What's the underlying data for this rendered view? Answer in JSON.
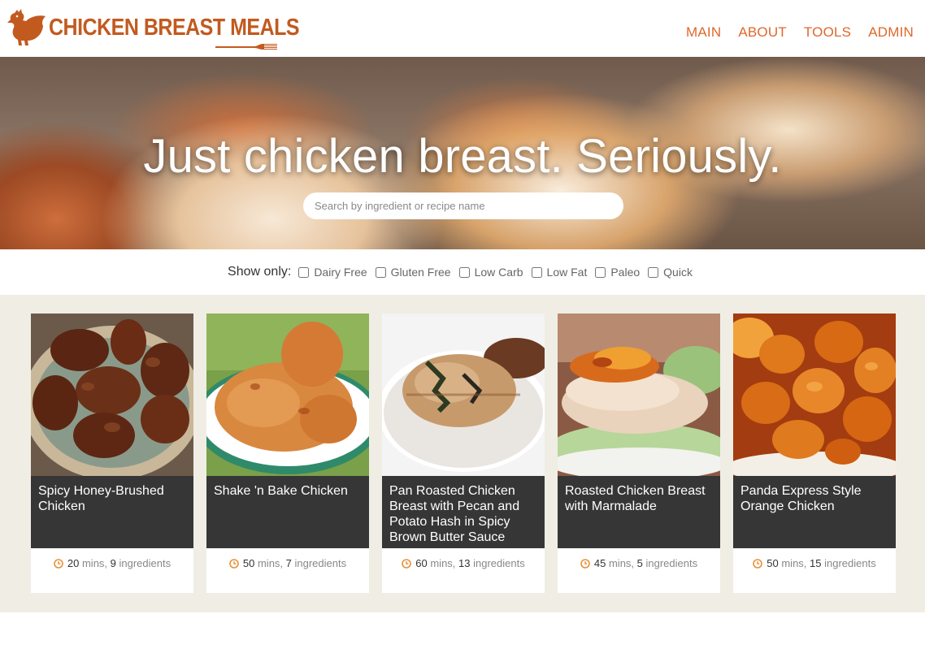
{
  "header": {
    "logo_text": "CHICKEN BREAST MEALS",
    "nav": [
      {
        "label": "MAIN"
      },
      {
        "label": "ABOUT"
      },
      {
        "label": "TOOLS"
      },
      {
        "label": "ADMIN"
      }
    ]
  },
  "hero": {
    "title": "Just chicken breast. Seriously.",
    "search_placeholder": "Search by ingredient or recipe name"
  },
  "filters": {
    "label": "Show only:",
    "options": [
      {
        "label": "Dairy Free",
        "checked": false
      },
      {
        "label": "Gluten Free",
        "checked": false
      },
      {
        "label": "Low Carb",
        "checked": false
      },
      {
        "label": "Low Fat",
        "checked": false
      },
      {
        "label": "Paleo",
        "checked": false
      },
      {
        "label": "Quick",
        "checked": false
      }
    ]
  },
  "recipes": [
    {
      "title": "Spicy Honey-Brushed Chicken",
      "mins": "20",
      "mins_label": " mins, ",
      "ingredients": "9",
      "ingredients_label": " ingredients"
    },
    {
      "title": "Shake 'n Bake Chicken",
      "mins": "50",
      "mins_label": " mins, ",
      "ingredients": "7",
      "ingredients_label": " ingredients"
    },
    {
      "title": "Pan Roasted Chicken Breast with Pecan and Potato Hash in Spicy Brown Butter Sauce",
      "mins": "60",
      "mins_label": " mins, ",
      "ingredients": "13",
      "ingredients_label": " ingredients"
    },
    {
      "title": "Roasted Chicken Breast with Marmalade",
      "mins": "45",
      "mins_label": " mins, ",
      "ingredients": "5",
      "ingredients_label": " ingredients"
    },
    {
      "title": "Panda Express Style Orange Chicken",
      "mins": "50",
      "mins_label": " mins, ",
      "ingredients": "15",
      "ingredients_label": " ingredients"
    }
  ],
  "colors": {
    "brand": "#c25a1f",
    "nav": "#e0672b",
    "card_title_bg": "#363636",
    "cards_area_bg": "#f0ede5",
    "clock": "#e8913a"
  },
  "icons": {
    "logo": "hen-icon",
    "logo_fork": "fork-icon",
    "meta": "clock-icon"
  }
}
